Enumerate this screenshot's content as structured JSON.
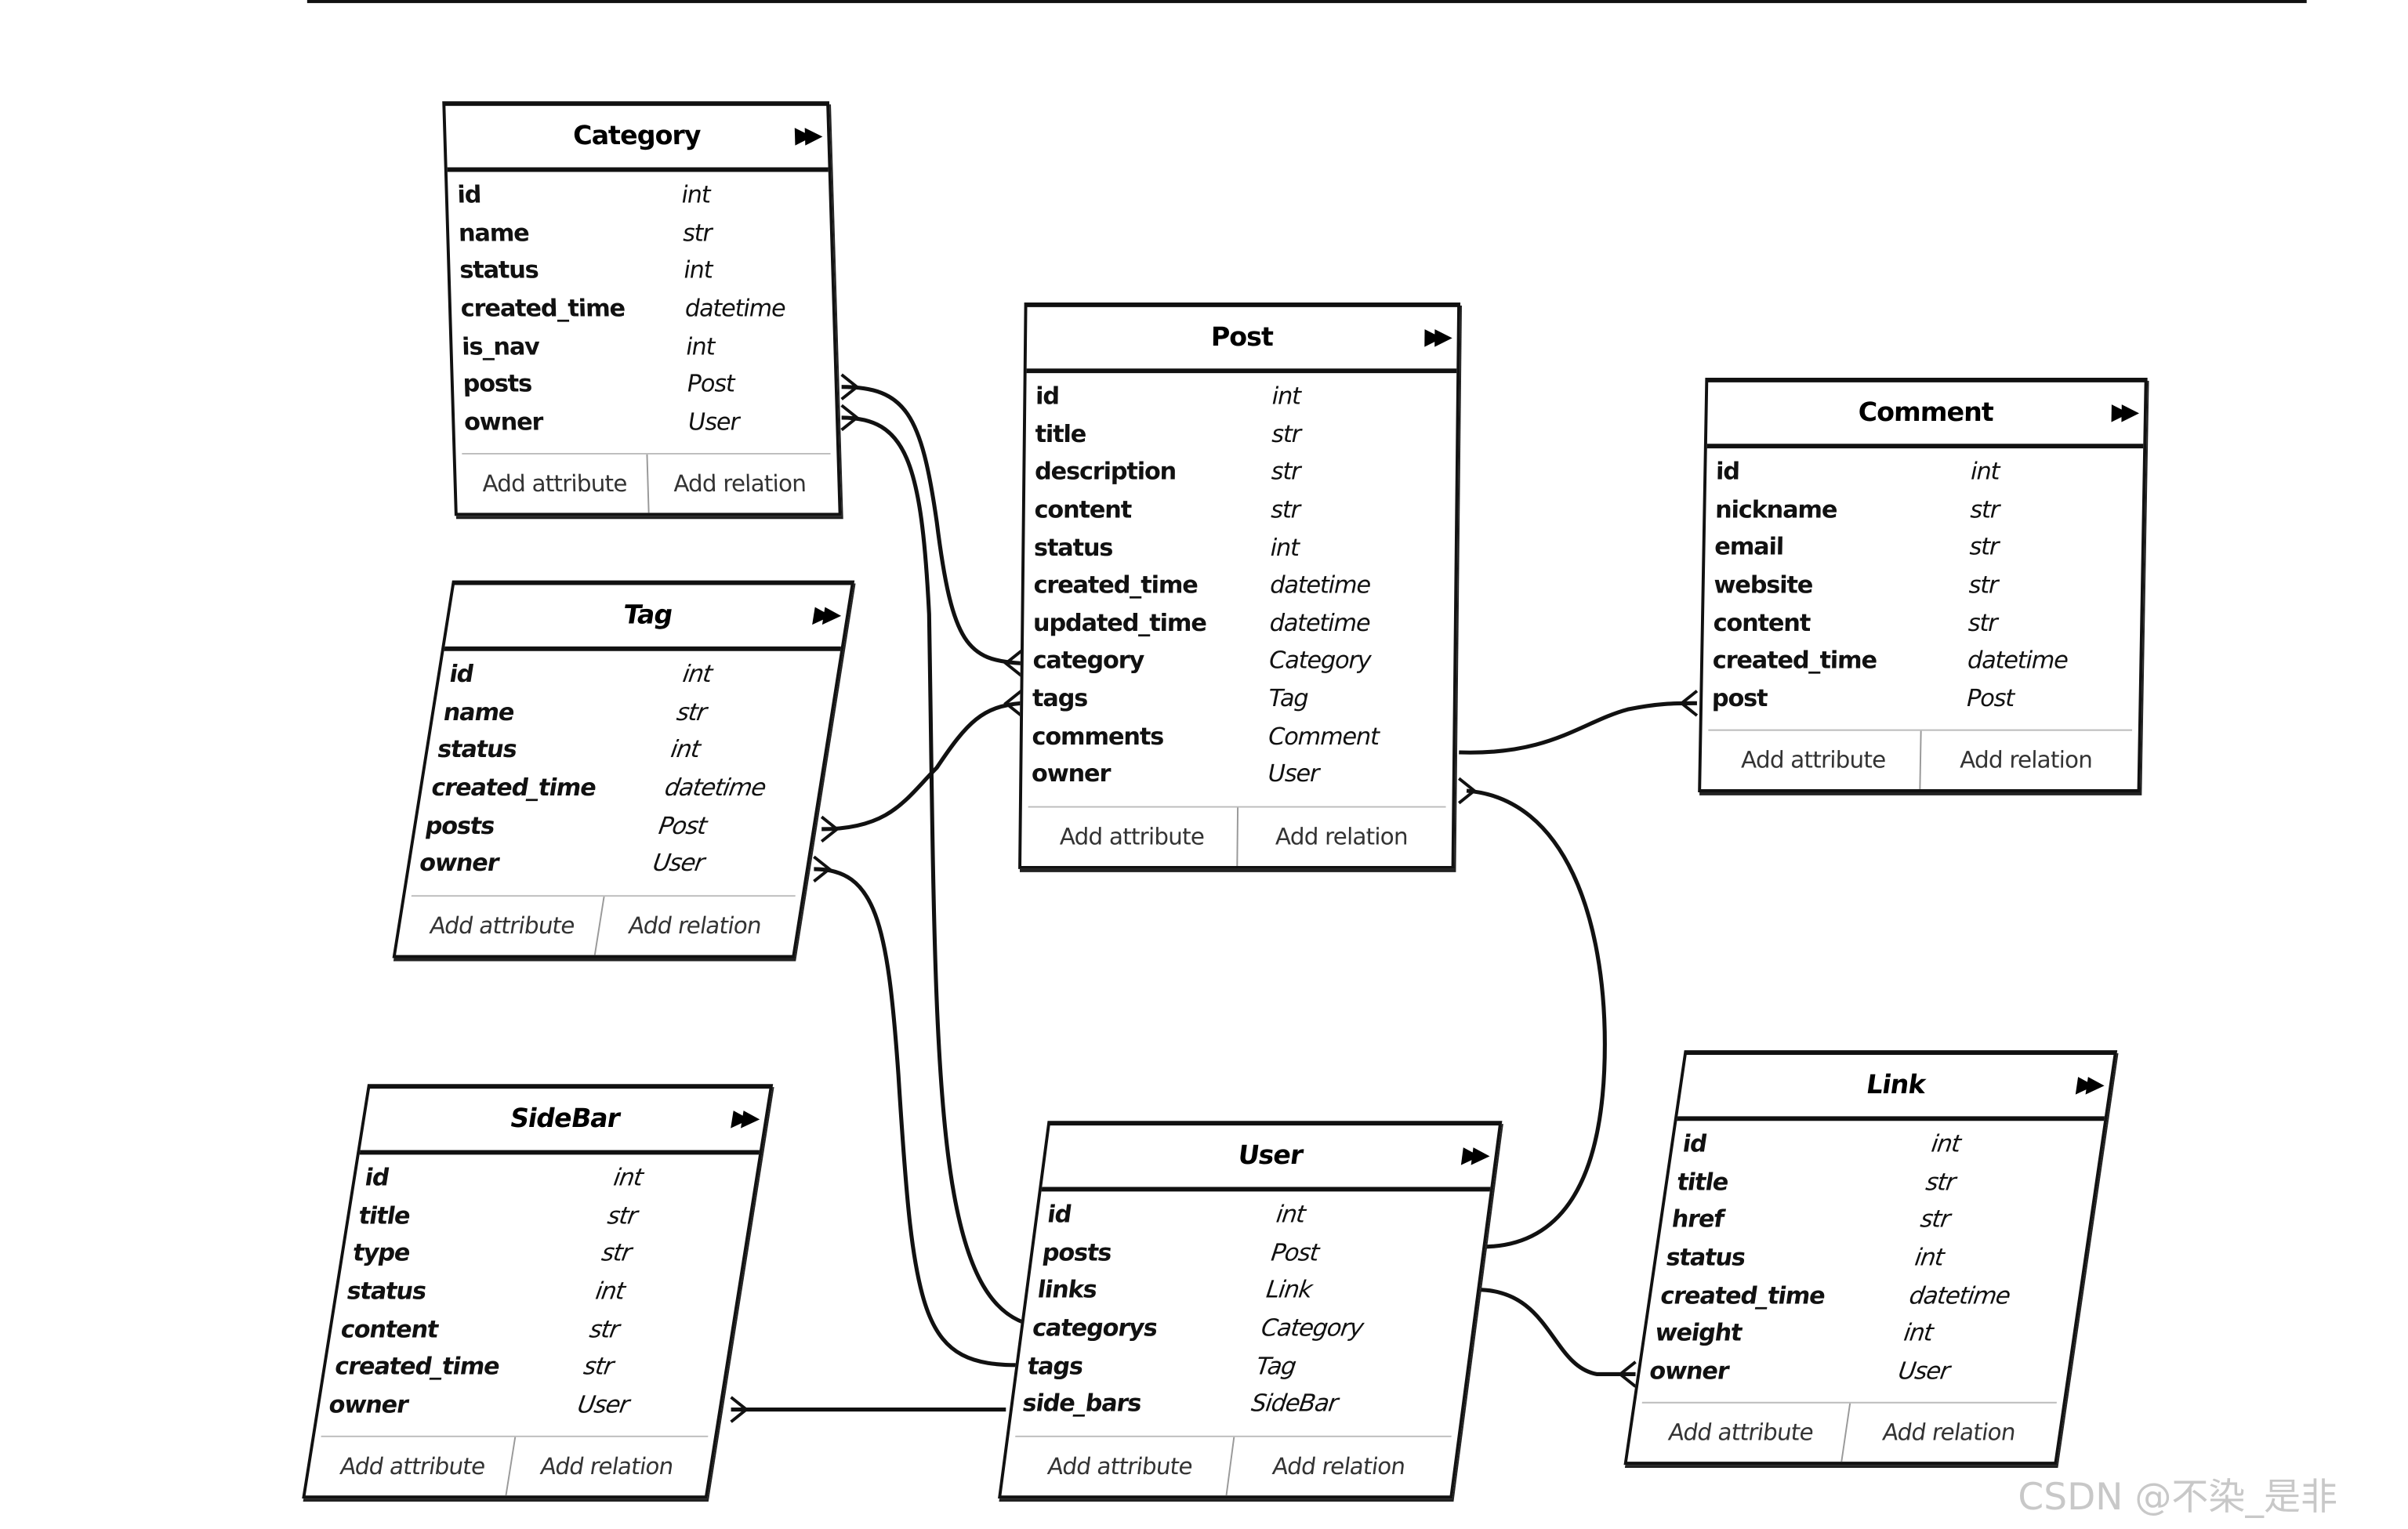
{
  "entities": [
    {
      "id": "category",
      "title": "Category",
      "attrs": [
        [
          "id",
          "int"
        ],
        [
          "name",
          "str"
        ],
        [
          "status",
          "int"
        ],
        [
          "created_time",
          "datetime"
        ],
        [
          "is_nav",
          "int"
        ],
        [
          "posts",
          "Post"
        ],
        [
          "owner",
          "User"
        ]
      ],
      "add_attribute": "Add attribute",
      "add_relation": "Add relation"
    },
    {
      "id": "post",
      "title": "Post",
      "attrs": [
        [
          "id",
          "int"
        ],
        [
          "title",
          "str"
        ],
        [
          "description",
          "str"
        ],
        [
          "content",
          "str"
        ],
        [
          "status",
          "int"
        ],
        [
          "created_time",
          "datetime"
        ],
        [
          "updated_time",
          "datetime"
        ],
        [
          "category",
          "Category"
        ],
        [
          "tags",
          "Tag"
        ],
        [
          "comments",
          "Comment"
        ],
        [
          "owner",
          "User"
        ]
      ],
      "add_attribute": "Add attribute",
      "add_relation": "Add relation"
    },
    {
      "id": "comment",
      "title": "Comment",
      "attrs": [
        [
          "id",
          "int"
        ],
        [
          "nickname",
          "str"
        ],
        [
          "email",
          "str"
        ],
        [
          "website",
          "str"
        ],
        [
          "content",
          "str"
        ],
        [
          "created_time",
          "datetime"
        ],
        [
          "post",
          "Post"
        ]
      ],
      "add_attribute": "Add attribute",
      "add_relation": "Add relation"
    },
    {
      "id": "tag",
      "title": "Tag",
      "attrs": [
        [
          "id",
          "int"
        ],
        [
          "name",
          "str"
        ],
        [
          "status",
          "int"
        ],
        [
          "created_time",
          "datetime"
        ],
        [
          "posts",
          "Post"
        ],
        [
          "owner",
          "User"
        ]
      ],
      "add_attribute": "Add attribute",
      "add_relation": "Add relation"
    },
    {
      "id": "sidebar",
      "title": "SideBar",
      "attrs": [
        [
          "id",
          "int"
        ],
        [
          "title",
          "str"
        ],
        [
          "type",
          "str"
        ],
        [
          "status",
          "int"
        ],
        [
          "content",
          "str"
        ],
        [
          "created_time",
          "str"
        ],
        [
          "owner",
          "User"
        ]
      ],
      "add_attribute": "Add attribute",
      "add_relation": "Add relation"
    },
    {
      "id": "user",
      "title": "User",
      "attrs": [
        [
          "id",
          "int"
        ],
        [
          "posts",
          "Post"
        ],
        [
          "links",
          "Link"
        ],
        [
          "categorys",
          "Category"
        ],
        [
          "tags",
          "Tag"
        ],
        [
          "side_bars",
          "SideBar"
        ]
      ],
      "add_attribute": "Add attribute",
      "add_relation": "Add relation"
    },
    {
      "id": "link",
      "title": "Link",
      "attrs": [
        [
          "id",
          "int"
        ],
        [
          "title",
          "str"
        ],
        [
          "href",
          "str"
        ],
        [
          "status",
          "int"
        ],
        [
          "created_time",
          "datetime"
        ],
        [
          "weight",
          "int"
        ],
        [
          "owner",
          "User"
        ]
      ],
      "add_attribute": "Add attribute",
      "add_relation": "Add relation"
    }
  ],
  "icons": {
    "expand": "double-chevron-right-icon"
  },
  "watermark": "CSDN @不染_是非"
}
